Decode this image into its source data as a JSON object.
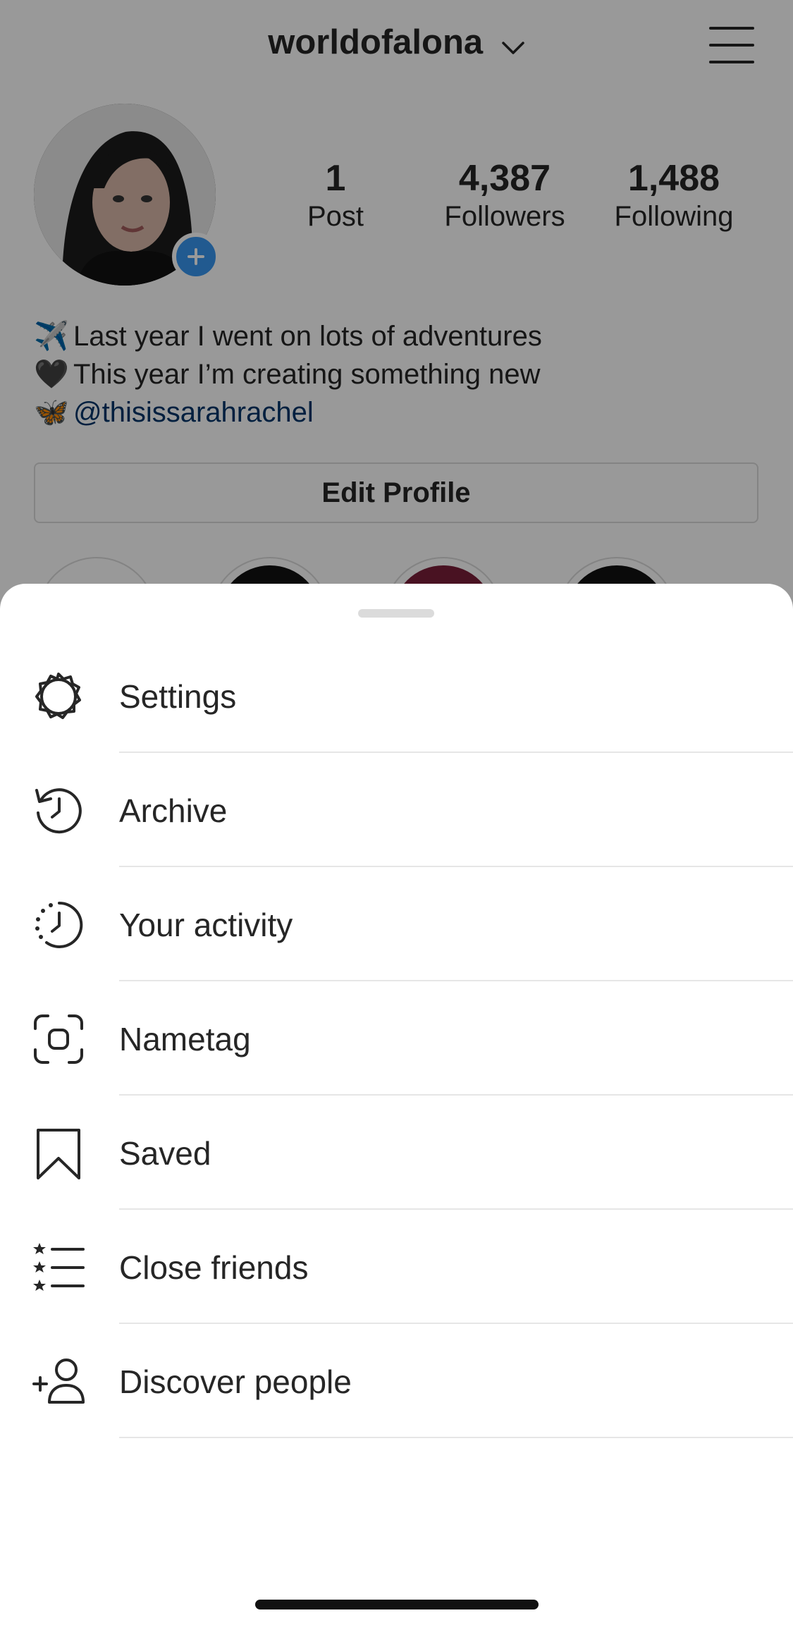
{
  "profile": {
    "username": "worldofalona",
    "stats": [
      {
        "value": "1",
        "label": "Post"
      },
      {
        "value": "4,387",
        "label": "Followers"
      },
      {
        "value": "1,488",
        "label": "Following"
      }
    ],
    "bio": [
      {
        "emoji": "✈️",
        "text": "Last year I went on lots of adventures"
      },
      {
        "emoji": "🖤",
        "text": "This year I’m creating something new"
      },
      {
        "emoji": "🦋",
        "text": "@thisissarahrachel"
      }
    ],
    "edit_profile_label": "Edit Profile"
  },
  "menu": {
    "items": [
      {
        "label": "Settings",
        "icon": "settings-icon"
      },
      {
        "label": "Archive",
        "icon": "archive-icon"
      },
      {
        "label": "Your activity",
        "icon": "activity-icon"
      },
      {
        "label": "Nametag",
        "icon": "nametag-icon"
      },
      {
        "label": "Saved",
        "icon": "bookmark-icon"
      },
      {
        "label": "Close friends",
        "icon": "close-friends-icon"
      },
      {
        "label": "Discover people",
        "icon": "add-person-icon"
      }
    ]
  },
  "colors": {
    "accent": "#3897f0",
    "link": "#003569",
    "text": "#262626",
    "separator": "#e6e6e6",
    "overlay": "rgba(0,0,0,0.4)"
  }
}
